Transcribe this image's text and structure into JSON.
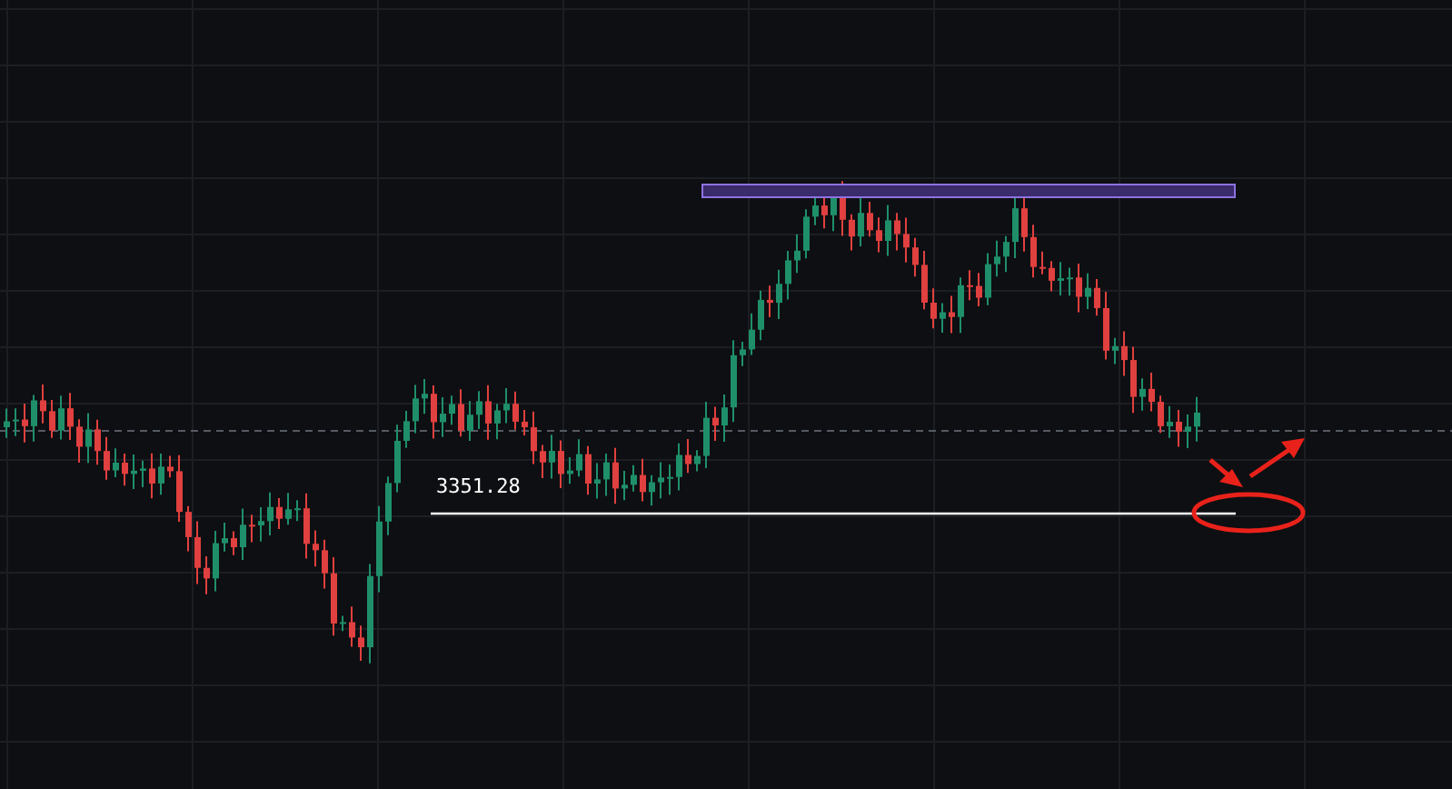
{
  "chart": {
    "price_line": {
      "label": "3351.28"
    }
  }
}
